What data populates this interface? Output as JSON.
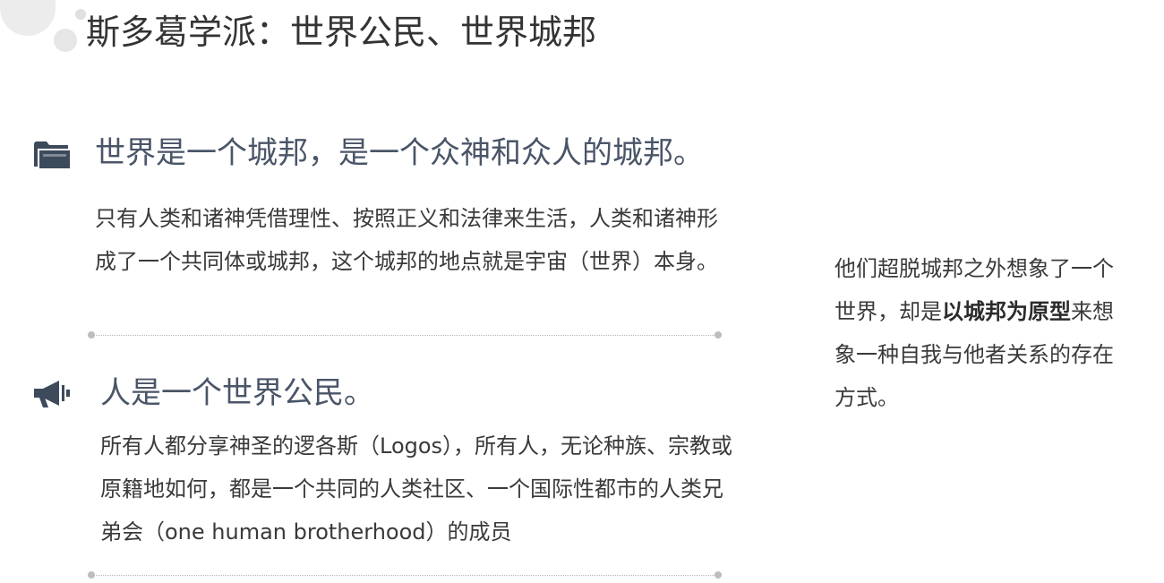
{
  "title": "斯多葛学派：世界公民、世界城邦",
  "sections": [
    {
      "heading": "世界是一个城邦，是一个众神和众人的城邦。",
      "icon": "folder-icon",
      "body": "只有人类和诸神凭借理性、按照正义和法律来生活，人类和诸神形成了一个共同体或城邦，这个城邦的地点就是宇宙（世界）本身。"
    },
    {
      "heading": "人是一个世界公民。",
      "icon": "megaphone-icon",
      "body": "所有人都分享神圣的逻各斯（Logos），所有人，无论种族、宗教或原籍地如何，都是一个共同的人类社区、一个国际性都市的人类兄弟会（one human brotherhood）的成员"
    }
  ],
  "side_note": {
    "before": "他们超脱城邦之外想象了一个世界，却是",
    "emphasis": "以城邦为原型",
    "after": "来想象一种自我与他者关系的存在方式。"
  },
  "colors": {
    "heading": "#4a5568",
    "icon": "#3d4a5c",
    "text": "#3a3a3a"
  }
}
